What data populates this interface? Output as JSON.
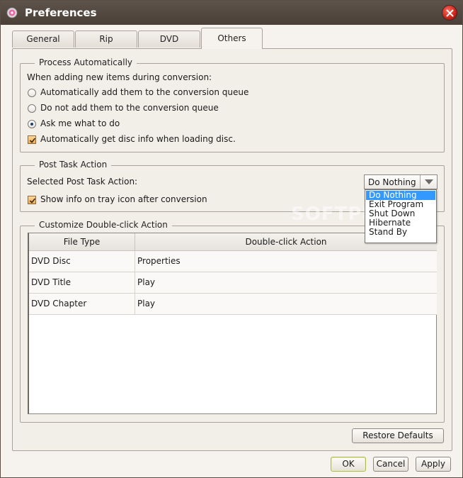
{
  "window": {
    "title": "Preferences"
  },
  "tabs": [
    {
      "label": "General",
      "active": false
    },
    {
      "label": "Rip",
      "active": false
    },
    {
      "label": "DVD",
      "active": false
    },
    {
      "label": "Others",
      "active": true
    }
  ],
  "process_auto": {
    "legend": "Process Automatically",
    "prompt": "When adding new items during conversion:",
    "options": [
      {
        "label": "Automatically add them to the conversion queue",
        "checked": false
      },
      {
        "label": "Do not add them to the conversion queue",
        "checked": false
      },
      {
        "label": "Ask me what to do",
        "checked": true
      }
    ],
    "disc_info": {
      "label": "Automatically get disc info when loading disc.",
      "checked": true
    }
  },
  "post_task": {
    "legend": "Post Task Action",
    "selected_label": "Selected Post Task Action:",
    "selected_value": "Do Nothing",
    "options": [
      "Do Nothing",
      "Exit Program",
      "Shut Down",
      "Hibernate",
      "Stand By"
    ],
    "tray_info": {
      "label": "Show info on tray icon after conversion",
      "checked": true
    }
  },
  "double_click": {
    "legend": "Customize Double-click Action",
    "columns": [
      "File Type",
      "Double-click Action"
    ],
    "rows": [
      {
        "type": "DVD Disc",
        "action": "Properties"
      },
      {
        "type": "DVD Title",
        "action": "Play"
      },
      {
        "type": "DVD Chapter",
        "action": "Play"
      }
    ]
  },
  "buttons": {
    "restore": "Restore Defaults",
    "ok": "OK",
    "cancel": "Cancel",
    "apply": "Apply"
  },
  "watermark": "SOFTPE",
  "colors": {
    "titlebar": "#4f453d",
    "selection": "#3399ff",
    "checkbox": "#f0a94b"
  }
}
